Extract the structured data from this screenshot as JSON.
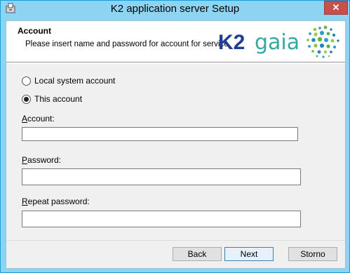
{
  "window": {
    "title": "K2 application server Setup",
    "close_glyph": "✕",
    "accent_color": "#8fd3f3"
  },
  "banner": {
    "title": "Account",
    "subtitle": "Please insert name and password for account for service",
    "logo_k2": "K2",
    "logo_word": "gaia"
  },
  "account_type": {
    "options": [
      {
        "label": "Local system account",
        "selected": false
      },
      {
        "label": "This account",
        "selected": true
      }
    ]
  },
  "fields": {
    "account": {
      "mnemonic": "A",
      "label_rest": "ccount:",
      "value": ""
    },
    "password": {
      "mnemonic": "P",
      "label_rest": "assword:",
      "value": ""
    },
    "repeat": {
      "mnemonic": "R",
      "label_rest": "epeat password:",
      "value": ""
    }
  },
  "buttons": {
    "back": "Back",
    "next": "Next",
    "cancel": "Storno"
  }
}
